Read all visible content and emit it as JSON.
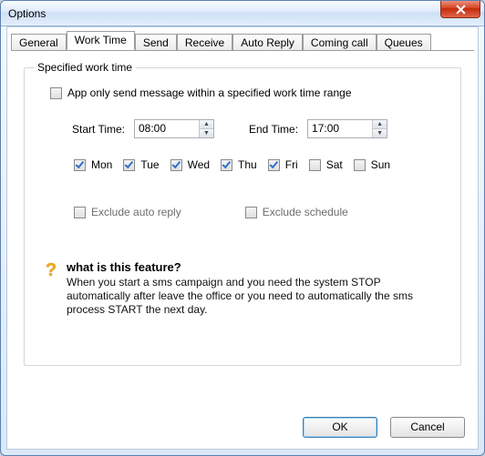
{
  "window": {
    "title": "Options"
  },
  "tabs": {
    "general": "General",
    "worktime": "Work Time",
    "send": "Send",
    "receive": "Receive",
    "autoreply": "Auto Reply",
    "coming": "Coming call",
    "queues": "Queues"
  },
  "group": {
    "title": "Specified work time",
    "enable_label": "App only send message within a specified work time range",
    "enable_checked": false,
    "start_label": "Start Time:",
    "start_value": "08:00",
    "end_label": "End Time:",
    "end_value": "17:00",
    "days": [
      {
        "label": "Mon",
        "checked": true
      },
      {
        "label": "Tue",
        "checked": true
      },
      {
        "label": "Wed",
        "checked": true
      },
      {
        "label": "Thu",
        "checked": true
      },
      {
        "label": "Fri",
        "checked": true
      },
      {
        "label": "Sat",
        "checked": false
      },
      {
        "label": "Sun",
        "checked": false
      }
    ],
    "exclude_autoreply": {
      "label": "Exclude auto reply",
      "checked": false
    },
    "exclude_schedule": {
      "label": "Exclude schedule",
      "checked": false
    }
  },
  "help": {
    "title": "what is this feature?",
    "body": "When you start a sms campaign and you need the system STOP automatically after leave the office or you need to automatically the sms process  START the next day."
  },
  "buttons": {
    "ok": "OK",
    "cancel": "Cancel"
  }
}
